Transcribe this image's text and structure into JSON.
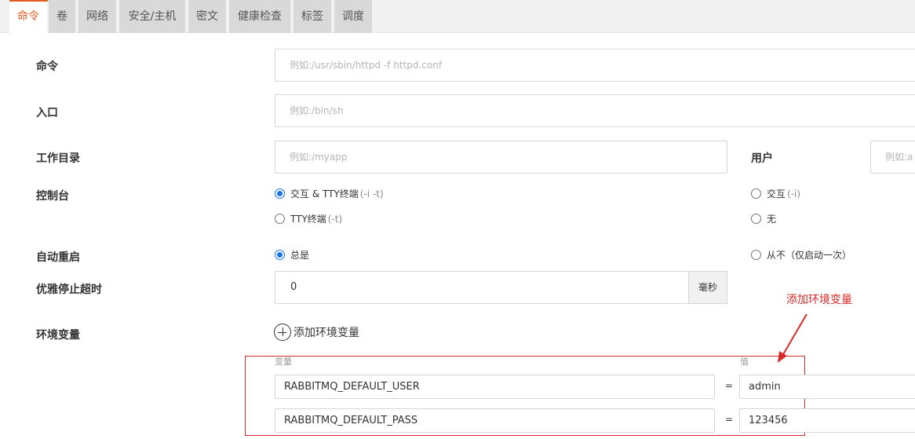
{
  "tabs": [
    {
      "label": "命令",
      "active": true
    },
    {
      "label": "卷"
    },
    {
      "label": "网络"
    },
    {
      "label": "安全/主机"
    },
    {
      "label": "密文"
    },
    {
      "label": "健康检查"
    },
    {
      "label": "标签"
    },
    {
      "label": "调度"
    }
  ],
  "form": {
    "command": {
      "label": "命令",
      "placeholder": "例如:/usr/sbin/httpd -f httpd.conf"
    },
    "entrypoint": {
      "label": "入口",
      "placeholder": "例如:/bin/sh"
    },
    "workdir": {
      "label": "工作目录",
      "placeholder": "例如:/myapp"
    },
    "user": {
      "label": "用户",
      "placeholder": "例如:a"
    },
    "console": {
      "label": "控制台",
      "options": [
        {
          "text": "交互 & TTY终端",
          "hint": "(-i -t)",
          "checked": true
        },
        {
          "text": "TTY终端",
          "hint": "(-t)",
          "checked": false
        },
        {
          "text": "交互",
          "hint": "(-i)",
          "checked": false
        },
        {
          "text": "无",
          "hint": "",
          "checked": false
        }
      ]
    },
    "restart": {
      "label": "自动重启",
      "options": [
        {
          "text": "总是",
          "checked": true
        },
        {
          "text": "从不（仅启动一次）",
          "checked": false
        }
      ]
    },
    "stop_timeout": {
      "label": "优雅停止超时",
      "value": "0",
      "unit": "毫秒"
    },
    "env": {
      "label": "环境变量",
      "add_label": "添加环境变量",
      "col_key": "变量",
      "col_value": "值",
      "rows": [
        {
          "key": "RABBITMQ_DEFAULT_USER",
          "eq": "=",
          "value": "admin"
        },
        {
          "key": "RABBITMQ_DEFAULT_PASS",
          "eq": "=",
          "value": "123456"
        }
      ]
    }
  },
  "annotation": {
    "text": "添加环境变量",
    "color": "#d42a2a"
  },
  "colors": {
    "accent": "#e35b1c",
    "radio": "#1a73e8"
  }
}
